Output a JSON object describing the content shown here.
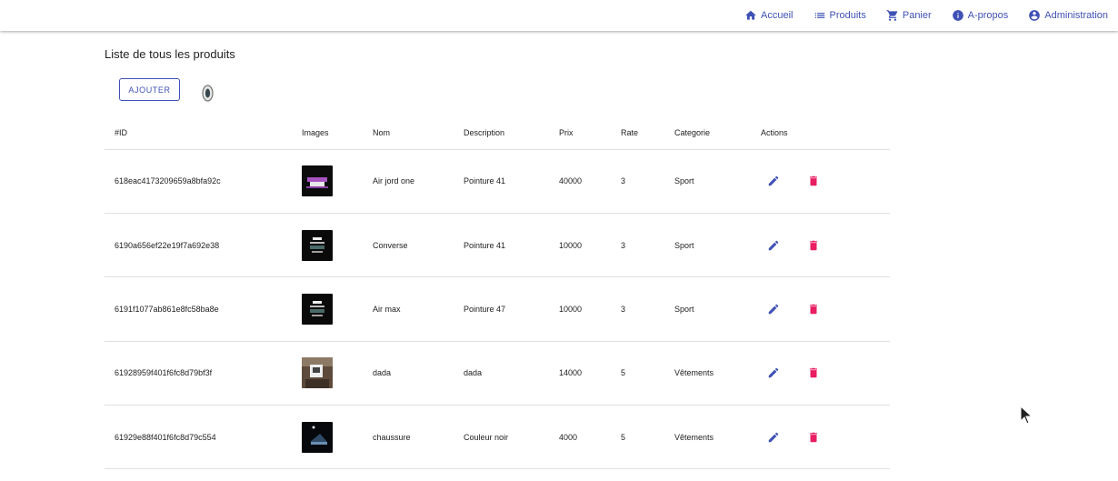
{
  "nav": {
    "items": [
      {
        "label": "Accueil",
        "icon": "home-icon"
      },
      {
        "label": "Produits",
        "icon": "list-icon"
      },
      {
        "label": "Panier",
        "icon": "cart-icon"
      },
      {
        "label": "A-propos",
        "icon": "info-icon"
      },
      {
        "label": "Administration",
        "icon": "account-circle-icon"
      }
    ]
  },
  "page": {
    "title": "Liste de tous les produits",
    "add_label": "AJOUTER"
  },
  "table": {
    "headers": [
      "#ID",
      "Images",
      "Nom",
      "Description",
      "Prix",
      "Rate",
      "Categorie",
      "Actions"
    ],
    "rows": [
      {
        "id": "618eac4173209659a8bfa92c",
        "nom": "Air jord one",
        "description": "Pointure 41",
        "prix": "40000",
        "rate": "3",
        "categorie": "Sport"
      },
      {
        "id": "6190a656ef22e19f7a692e38",
        "nom": "Converse",
        "description": "Pointure 41",
        "prix": "10000",
        "rate": "3",
        "categorie": "Sport"
      },
      {
        "id": "6191f1077ab861e8fc58ba8e",
        "nom": "Air max",
        "description": "Pointure 47",
        "prix": "10000",
        "rate": "3",
        "categorie": "Sport"
      },
      {
        "id": "61928959f401f6fc8d79bf3f",
        "nom": "dada",
        "description": "dada",
        "prix": "14000",
        "rate": "5",
        "categorie": "Vêtements"
      },
      {
        "id": "61929e88f401f6fc8d79c554",
        "nom": "chaussure",
        "description": "Couleur noir",
        "prix": "4000",
        "rate": "5",
        "categorie": "Vêtements"
      }
    ]
  },
  "colors": {
    "primary": "#3f51b5",
    "delete": "#e91e63"
  }
}
